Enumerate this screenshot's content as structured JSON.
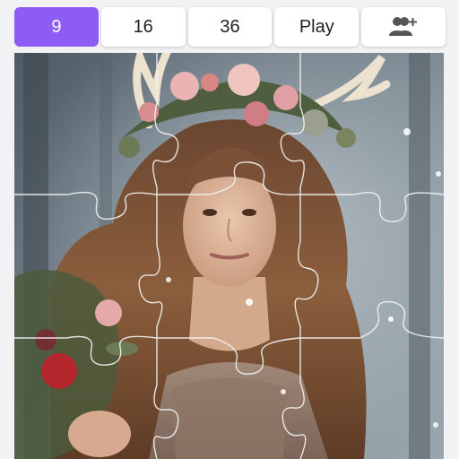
{
  "toolbar": {
    "buttons": [
      {
        "label": "9",
        "active": true
      },
      {
        "label": "16",
        "active": false
      },
      {
        "label": "36",
        "active": false
      },
      {
        "label": "Play",
        "active": false
      }
    ],
    "invite_icon": "add-user-icon"
  },
  "puzzle": {
    "pieces": 9,
    "columns": 3,
    "rows": 3
  },
  "colors": {
    "accent": "#8c5cf4",
    "button_bg": "#ffffff",
    "page_bg": "#f2f2f4",
    "piece_outline": "#f4f4f4"
  }
}
